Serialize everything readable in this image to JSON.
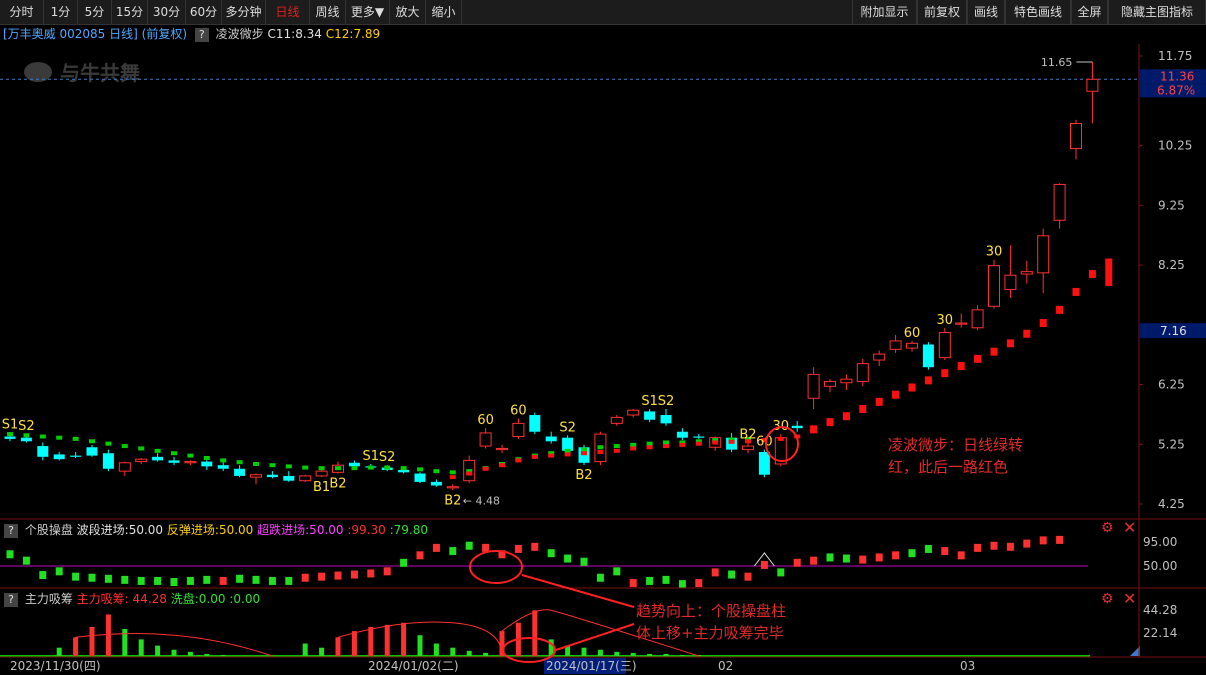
{
  "toolbar": {
    "left_tabs": [
      "分时",
      "1分",
      "5分",
      "15分",
      "30分",
      "60分",
      "多分钟",
      "日线",
      "周线",
      "更多▼",
      "放大",
      "缩小"
    ],
    "active_tab": "日线",
    "right_tabs": [
      "附加显示",
      "前复权",
      "画线",
      "特色画线",
      "全屏",
      "隐藏主图指标"
    ]
  },
  "info": {
    "stock": "[万丰奥威 002085 日线]",
    "adjust": "(前复权)",
    "indicator": "凌波微步",
    "c11": "C11:8.34",
    "c12": "C12:7.89"
  },
  "watermark": "与牛共舞",
  "price_labels": {
    "current": "11.36",
    "change": "6.87%",
    "marker": "7.16",
    "high": "11.65",
    "low": "4.48"
  },
  "panel2": {
    "name": "个股操盘",
    "wave": "波段进场:50.00",
    "rebound": "反弹进场:50.00",
    "super": "超跌进场:50.00",
    "v1": ":99.30",
    "v2": ":79.80",
    "ticks": [
      "95.00",
      "50.00"
    ]
  },
  "panel3": {
    "name": "主力吸筹",
    "absorb": "主力吸筹:",
    "absorb_val": "44.28",
    "wash": "洗盘:0.00",
    "v3": ":0.00",
    "ticks": [
      "44.28",
      "22.14"
    ]
  },
  "annotations": {
    "a1_l1": "凌波微步：日线绿转",
    "a1_l2": "红，此后一路红色",
    "a2_l1": "趋势向上：个股操盘柱",
    "a2_l2": "体上移+主力吸筹完毕"
  },
  "chart_data": [
    {
      "type": "candlestick",
      "title": "",
      "y_ticks": [
        "11.75",
        "10.25",
        "9.25",
        "8.25",
        "6.25",
        "5.25",
        "4.25"
      ],
      "ylim": [
        4.25,
        11.75
      ],
      "grid": false,
      "candles": [
        {
          "o": 5.38,
          "h": 5.45,
          "l": 5.3,
          "c": 5.34
        },
        {
          "o": 5.36,
          "h": 5.42,
          "l": 5.28,
          "c": 5.3
        },
        {
          "o": 5.22,
          "h": 5.28,
          "l": 4.98,
          "c": 5.04
        },
        {
          "o": 5.08,
          "h": 5.12,
          "l": 4.98,
          "c": 5.0
        },
        {
          "o": 5.06,
          "h": 5.12,
          "l": 5.02,
          "c": 5.04
        },
        {
          "o": 5.2,
          "h": 5.24,
          "l": 5.04,
          "c": 5.06
        },
        {
          "o": 5.1,
          "h": 5.16,
          "l": 4.8,
          "c": 4.84
        },
        {
          "o": 4.8,
          "h": 4.96,
          "l": 4.72,
          "c": 4.94
        },
        {
          "o": 4.96,
          "h": 5.02,
          "l": 4.92,
          "c": 5.0
        },
        {
          "o": 5.04,
          "h": 5.1,
          "l": 4.96,
          "c": 4.98
        },
        {
          "o": 4.98,
          "h": 5.04,
          "l": 4.9,
          "c": 4.94
        },
        {
          "o": 4.94,
          "h": 4.98,
          "l": 4.9,
          "c": 4.96
        },
        {
          "o": 4.96,
          "h": 4.98,
          "l": 4.82,
          "c": 4.88
        },
        {
          "o": 4.9,
          "h": 4.96,
          "l": 4.8,
          "c": 4.84
        },
        {
          "o": 4.84,
          "h": 4.9,
          "l": 4.7,
          "c": 4.72
        },
        {
          "o": 4.7,
          "h": 4.76,
          "l": 4.58,
          "c": 4.74
        },
        {
          "o": 4.74,
          "h": 4.8,
          "l": 4.68,
          "c": 4.7
        },
        {
          "o": 4.72,
          "h": 4.8,
          "l": 4.62,
          "c": 4.64
        },
        {
          "o": 4.64,
          "h": 4.74,
          "l": 4.62,
          "c": 4.72
        },
        {
          "o": 4.72,
          "h": 4.82,
          "l": 4.7,
          "c": 4.8
        },
        {
          "o": 4.78,
          "h": 4.96,
          "l": 4.76,
          "c": 4.9
        },
        {
          "o": 4.94,
          "h": 4.98,
          "l": 4.84,
          "c": 4.88
        },
        {
          "o": 4.88,
          "h": 4.92,
          "l": 4.84,
          "c": 4.86
        },
        {
          "o": 4.86,
          "h": 4.9,
          "l": 4.8,
          "c": 4.82
        },
        {
          "o": 4.82,
          "h": 4.86,
          "l": 4.76,
          "c": 4.78
        },
        {
          "o": 4.76,
          "h": 4.78,
          "l": 4.6,
          "c": 4.62
        },
        {
          "o": 4.62,
          "h": 4.66,
          "l": 4.54,
          "c": 4.56
        },
        {
          "o": 4.52,
          "h": 4.58,
          "l": 4.48,
          "c": 4.54
        },
        {
          "o": 4.64,
          "h": 5.06,
          "l": 4.6,
          "c": 4.98
        },
        {
          "o": 5.22,
          "h": 5.52,
          "l": 5.18,
          "c": 5.44
        },
        {
          "o": 5.16,
          "h": 5.24,
          "l": 5.1,
          "c": 5.18
        },
        {
          "o": 5.38,
          "h": 5.68,
          "l": 5.34,
          "c": 5.6
        },
        {
          "o": 5.74,
          "h": 5.78,
          "l": 5.42,
          "c": 5.46
        },
        {
          "o": 5.38,
          "h": 5.46,
          "l": 5.26,
          "c": 5.3
        },
        {
          "o": 5.36,
          "h": 5.4,
          "l": 5.1,
          "c": 5.14
        },
        {
          "o": 5.2,
          "h": 5.24,
          "l": 4.9,
          "c": 4.94
        },
        {
          "o": 4.96,
          "h": 5.46,
          "l": 4.9,
          "c": 5.42
        },
        {
          "o": 5.6,
          "h": 5.74,
          "l": 5.56,
          "c": 5.7
        },
        {
          "o": 5.74,
          "h": 5.84,
          "l": 5.7,
          "c": 5.82
        },
        {
          "o": 5.8,
          "h": 5.84,
          "l": 5.62,
          "c": 5.66
        },
        {
          "o": 5.74,
          "h": 5.84,
          "l": 5.56,
          "c": 5.6
        },
        {
          "o": 5.46,
          "h": 5.52,
          "l": 5.32,
          "c": 5.36
        },
        {
          "o": 5.38,
          "h": 5.42,
          "l": 5.34,
          "c": 5.36
        },
        {
          "o": 5.2,
          "h": 5.38,
          "l": 5.14,
          "c": 5.36
        },
        {
          "o": 5.36,
          "h": 5.44,
          "l": 5.12,
          "c": 5.16
        },
        {
          "o": 5.16,
          "h": 5.28,
          "l": 5.1,
          "c": 5.22
        },
        {
          "o": 5.12,
          "h": 5.16,
          "l": 4.7,
          "c": 4.74
        },
        {
          "o": 4.92,
          "h": 5.42,
          "l": 4.88,
          "c": 5.36
        },
        {
          "o": 5.56,
          "h": 5.64,
          "l": 5.46,
          "c": 5.52
        },
        {
          "o": 6.02,
          "h": 6.54,
          "l": 5.84,
          "c": 6.42
        },
        {
          "o": 6.22,
          "h": 6.34,
          "l": 6.12,
          "c": 6.3
        },
        {
          "o": 6.28,
          "h": 6.42,
          "l": 6.16,
          "c": 6.34
        },
        {
          "o": 6.3,
          "h": 6.68,
          "l": 6.22,
          "c": 6.6
        },
        {
          "o": 6.66,
          "h": 6.82,
          "l": 6.56,
          "c": 6.76
        },
        {
          "o": 6.84,
          "h": 7.08,
          "l": 6.78,
          "c": 6.98
        },
        {
          "o": 6.86,
          "h": 6.98,
          "l": 6.8,
          "c": 6.94
        },
        {
          "o": 6.92,
          "h": 6.96,
          "l": 6.5,
          "c": 6.54
        },
        {
          "o": 6.7,
          "h": 7.2,
          "l": 6.66,
          "c": 7.12
        },
        {
          "o": 7.26,
          "h": 7.44,
          "l": 7.2,
          "c": 7.28
        },
        {
          "o": 7.2,
          "h": 7.58,
          "l": 7.16,
          "c": 7.5
        },
        {
          "o": 7.56,
          "h": 8.34,
          "l": 7.52,
          "c": 8.24
        },
        {
          "o": 7.84,
          "h": 8.58,
          "l": 7.7,
          "c": 8.08
        },
        {
          "o": 8.1,
          "h": 8.32,
          "l": 7.94,
          "c": 8.14
        },
        {
          "o": 8.12,
          "h": 8.86,
          "l": 7.78,
          "c": 8.74
        },
        {
          "o": 9.0,
          "h": 9.62,
          "l": 8.86,
          "c": 9.6
        },
        {
          "o": 10.2,
          "h": 10.68,
          "l": 10.02,
          "c": 10.62
        },
        {
          "o": 11.16,
          "h": 11.65,
          "l": 10.62,
          "c": 11.36
        }
      ],
      "lwwb": {
        "green": [
          5.42,
          5.4,
          5.38,
          5.36,
          5.34,
          5.3,
          5.26,
          5.22,
          5.18,
          5.14,
          5.1,
          5.06,
          5.02,
          4.98,
          4.95,
          4.92,
          4.9,
          4.88,
          4.86,
          4.85,
          4.85,
          4.85,
          4.86,
          4.86,
          4.85,
          4.83,
          4.8,
          4.78,
          4.8,
          4.85,
          4.92,
          5.0,
          5.06,
          5.1,
          5.14,
          5.16,
          5.2,
          5.22,
          5.24,
          5.26,
          5.28,
          5.28,
          5.3,
          5.32,
          5.33,
          5.34
        ],
        "red_start": 27,
        "red": [
          4.7,
          4.76,
          4.84,
          4.9,
          4.98,
          5.04,
          5.06,
          5.08,
          5.1,
          5.12,
          5.14,
          5.18,
          5.2,
          5.22,
          5.24,
          5.26,
          5.28,
          5.29,
          5.3,
          5.32,
          5.34,
          5.38,
          5.5,
          5.62,
          5.72,
          5.84,
          5.96,
          6.08,
          6.2,
          6.32,
          6.44,
          6.56,
          6.68,
          6.8,
          6.94,
          7.1,
          7.28,
          7.5,
          7.8,
          8.1
        ]
      },
      "signals": [
        {
          "i": 0,
          "text": "S1",
          "pos": "above"
        },
        {
          "i": 1,
          "text": "S2",
          "pos": "above"
        },
        {
          "i": 19,
          "text": "B1",
          "pos": "below"
        },
        {
          "i": 20,
          "text": "B2",
          "pos": "below"
        },
        {
          "i": 22,
          "text": "S1",
          "pos": "above"
        },
        {
          "i": 23,
          "text": "S2",
          "pos": "above"
        },
        {
          "i": 27,
          "text": "B2",
          "pos": "below"
        },
        {
          "i": 29,
          "text": "60",
          "pos": "above"
        },
        {
          "i": 31,
          "text": "60",
          "pos": "above"
        },
        {
          "i": 34,
          "text": "S2",
          "pos": "above"
        },
        {
          "i": 35,
          "text": "B2",
          "pos": "below"
        },
        {
          "i": 39,
          "text": "S1",
          "pos": "above"
        },
        {
          "i": 40,
          "text": "S2",
          "pos": "above"
        },
        {
          "i": 45,
          "text": "B2",
          "pos": "above"
        },
        {
          "i": 46,
          "text": "60",
          "pos": "above"
        },
        {
          "i": 47,
          "text": "30",
          "pos": "above"
        },
        {
          "i": 55,
          "text": "60",
          "pos": "above"
        },
        {
          "i": 57,
          "text": "30",
          "pos": "above"
        },
        {
          "i": 60,
          "text": "30",
          "pos": "above"
        }
      ]
    },
    {
      "type": "bar",
      "title": "个股操盘",
      "y_ticks": [
        "95.00",
        "50.00"
      ],
      "ylim": [
        0,
        100
      ],
      "baseline": 50,
      "values": [
        72,
        60,
        33,
        40,
        30,
        28,
        26,
        24,
        22,
        22,
        20,
        22,
        24,
        22,
        26,
        24,
        22,
        22,
        28,
        30,
        32,
        34,
        36,
        40,
        56,
        70,
        84,
        78,
        88,
        84,
        72,
        82,
        86,
        74,
        64,
        58,
        28,
        40,
        18,
        22,
        24,
        16,
        18,
        38,
        34,
        30,
        52,
        38,
        56,
        60,
        66,
        64,
        62,
        66,
        70,
        74,
        82,
        78,
        70,
        84,
        88,
        86,
        92,
        98,
        99
      ],
      "up": [
        false,
        false,
        false,
        false,
        false,
        false,
        false,
        false,
        false,
        false,
        false,
        false,
        false,
        true,
        false,
        false,
        false,
        false,
        true,
        true,
        true,
        true,
        true,
        true,
        false,
        true,
        true,
        false,
        false,
        true,
        true,
        true,
        true,
        false,
        false,
        false,
        false,
        false,
        true,
        false,
        false,
        false,
        true,
        true,
        false,
        true,
        true,
        false,
        true,
        true,
        false,
        false,
        true,
        true,
        true,
        false,
        false,
        true,
        true,
        true,
        true,
        true,
        true,
        true,
        true
      ]
    },
    {
      "type": "bar",
      "title": "主力吸筹",
      "y_ticks": [
        "44.28",
        "22.14"
      ],
      "ylim": [
        0,
        50
      ],
      "red": [
        0,
        0,
        0,
        0,
        18,
        28,
        40,
        0,
        0,
        0,
        0,
        0,
        0,
        0,
        0,
        0,
        0,
        0,
        0,
        0,
        18,
        24,
        28,
        30,
        32,
        0,
        0,
        0,
        0,
        0,
        24,
        32,
        44,
        0,
        0,
        0,
        0,
        0,
        0,
        0,
        0,
        0,
        0,
        0,
        0,
        0,
        0,
        0,
        0,
        0,
        0,
        0,
        0,
        0,
        0,
        0,
        0,
        0,
        0,
        0,
        0,
        0,
        0,
        0,
        0
      ],
      "green": [
        0,
        0,
        0,
        8,
        0,
        0,
        0,
        26,
        16,
        10,
        6,
        4,
        2,
        1,
        0,
        0,
        0,
        0,
        12,
        8,
        0,
        0,
        0,
        0,
        0,
        20,
        12,
        8,
        5,
        3,
        0,
        0,
        0,
        16,
        10,
        8,
        6,
        4,
        3,
        2,
        2,
        1,
        1,
        0,
        0,
        0,
        0,
        0,
        0,
        0,
        0,
        0,
        0,
        0,
        0,
        0,
        0,
        0,
        0,
        0,
        0,
        0,
        0,
        0,
        0
      ]
    }
  ],
  "date_axis": [
    "2023/11/30(四)",
    "2024/01/02(二)",
    "2024/01/17(三)",
    "02",
    "03"
  ],
  "colors": {
    "up": "#ff3030",
    "down": "#00ffff",
    "lwwb_green": "#00d000",
    "lwwb_red": "#ff1010",
    "signal": "#ffe040",
    "line50": "#c000c0",
    "baseline": "#00c000"
  }
}
